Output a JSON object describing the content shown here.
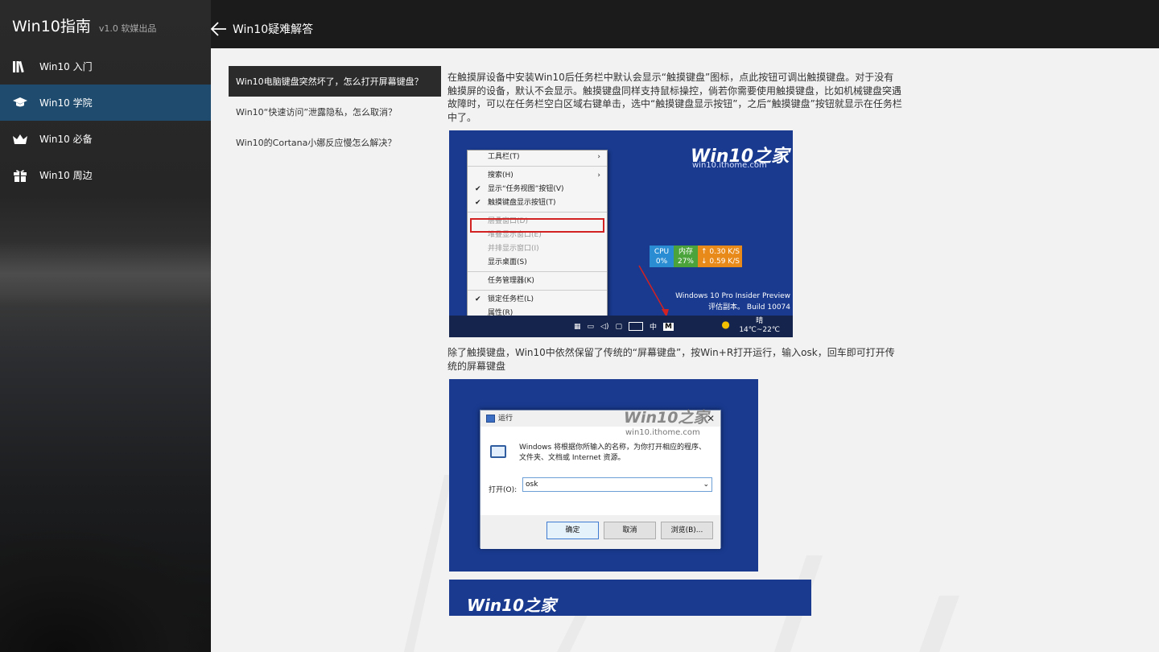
{
  "app": {
    "title": "Win10指南",
    "version": "v1.0 软媒出品"
  },
  "nav": {
    "items": [
      {
        "label": "Win10 入门",
        "icon": "library-icon",
        "active": false
      },
      {
        "label": "Win10 学院",
        "icon": "graduation-cap-icon",
        "active": true
      },
      {
        "label": "Win10 必备",
        "icon": "crown-icon",
        "active": false
      },
      {
        "label": "Win10 周边",
        "icon": "gift-icon",
        "active": false
      }
    ]
  },
  "header": {
    "title": "Win10疑难解答"
  },
  "questions": [
    {
      "text": "Win10电脑键盘突然坏了，怎么打开屏幕键盘？",
      "active": true
    },
    {
      "text": "Win10“快速访问”泄露隐私，怎么取消？",
      "active": false
    },
    {
      "text": "Win10的Cortana小娜反应慢怎么解决？",
      "active": false
    }
  ],
  "article": {
    "para1": "在触摸屏设备中安装Win10后任务栏中默认会显示“触摸键盘”图标，点此按钮可调出触摸键盘。对于没有触摸屏的设备，默认不会显示。触摸键盘同样支持鼠标操控，倘若你需要使用触摸键盘，比如机械键盘突遇故障时，可以在任务栏空白区域右键单击，选中“触摸键盘显示按钮”，之后“触摸键盘”按钮就显示在任务栏中了。",
    "para2": "除了触摸键盘，Win10中依然保留了传统的“屏幕键盘”，按Win+R打开运行，输入osk，回车即可打开传统的屏幕键盘"
  },
  "screenshot1": {
    "logo": "Win10之家",
    "url": "win10.ithome.com",
    "menu": [
      {
        "label": "工具栏(T)",
        "submenu": true,
        "checked": false,
        "disabled": false
      },
      {
        "sep": true
      },
      {
        "label": "搜索(H)",
        "submenu": true,
        "checked": false,
        "disabled": false
      },
      {
        "label": "显示“任务视图”按钮(V)",
        "submenu": false,
        "checked": true,
        "disabled": false
      },
      {
        "label": "触摸键盘显示按钮(T)",
        "submenu": false,
        "checked": true,
        "disabled": false
      },
      {
        "sep": true
      },
      {
        "label": "层叠窗口(D)",
        "submenu": false,
        "checked": false,
        "disabled": true
      },
      {
        "label": "堆叠显示窗口(E)",
        "submenu": false,
        "checked": false,
        "disabled": true
      },
      {
        "label": "并排显示窗口(I)",
        "submenu": false,
        "checked": false,
        "disabled": true
      },
      {
        "label": "显示桌面(S)",
        "submenu": false,
        "checked": false,
        "disabled": false
      },
      {
        "sep": true
      },
      {
        "label": "任务管理器(K)",
        "submenu": false,
        "checked": false,
        "disabled": false
      },
      {
        "sep": true
      },
      {
        "label": "锁定任务栏(L)",
        "submenu": false,
        "checked": true,
        "disabled": false
      },
      {
        "label": "属性(R)",
        "submenu": false,
        "checked": false,
        "disabled": false
      }
    ],
    "monitor": {
      "cpu_label": "CPU",
      "cpu_value": "0%",
      "mem_label": "内存",
      "mem_value": "27%",
      "up": "0.30 K/S",
      "down": "0.59 K/S"
    },
    "win_info_1": "Windows 10 Pro Insider Preview",
    "win_info_2": "评估副本。 Build 10074",
    "taskbar_lang": "中",
    "taskbar_ime": "M",
    "weather_1": "晴",
    "weather_2": "14℃~22℃"
  },
  "screenshot2": {
    "logo": "Win10之家",
    "url": "win10.ithome.com",
    "dialog_title": "运行",
    "desc": "Windows 将根据你所输入的名称，为你打开相应的程序、文件夹、文档或 Internet 资源。",
    "open_label": "打开(O):",
    "input_value": "osk",
    "ok": "确定",
    "cancel": "取消",
    "browse": "浏览(B)..."
  },
  "screenshot3": {
    "logo": "Win10之家"
  },
  "colors": {
    "accent": "#1f4c6e",
    "sidebar": "#262626",
    "content_bg": "#f2f2f2",
    "screenshot_blue": "#193a8f"
  }
}
